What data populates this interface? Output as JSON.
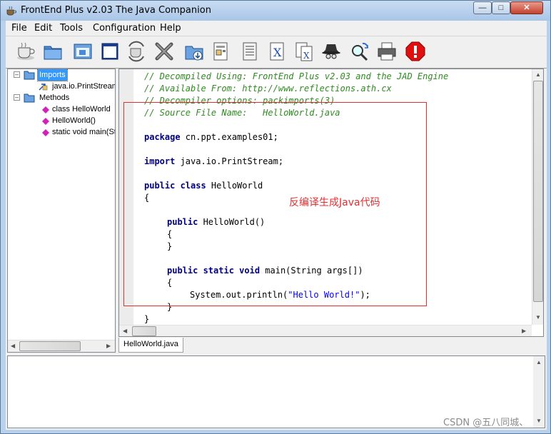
{
  "window": {
    "title": "FrontEnd Plus v2.03 The Java Companion",
    "minimize_label": "—",
    "maximize_label": "□",
    "close_label": "✕"
  },
  "menu": [
    "File",
    "Edit",
    "Tools",
    "Configuration",
    "Help"
  ],
  "toolbar_icons": [
    "coffee-cup-icon",
    "open-folder-icon",
    "open-window-icon",
    "blank-window-icon",
    "recycle-cup-icon",
    "tools-cross-icon",
    "download-folder-icon",
    "properties-doc-icon",
    "list-doc-icon",
    "x-file-icon",
    "x-files-icon",
    "spy-hat-icon",
    "search-refresh-icon",
    "printer-icon",
    "stop-icon"
  ],
  "tree": {
    "imports_label": "Imports",
    "import_item": "java.io.PrintStream",
    "methods_label": "Methods",
    "method_items": [
      "class HelloWorld",
      "HelloWorld()",
      "static void main(St"
    ]
  },
  "editor": {
    "comments": [
      "// Decompiled Using: FrontEnd Plus v2.03 and the JAD Engine",
      "// Available From: http://www.reflections.ath.cx",
      "// Decompiler options: packimports(3)",
      "// Source File Name:   HelloWorld.java"
    ],
    "kw_package": "package",
    "package_name": " cn.ppt.examples01;",
    "kw_import": "import",
    "import_name": " java.io.PrintStream;",
    "kw_public_class": "public class",
    "class_name": " HelloWorld",
    "open_brace": "{",
    "close_brace": "}",
    "kw_public": "public",
    "ctor": " HelloWorld()",
    "kw_public_static_void": "public static void",
    "main_sig": " main(String args[])",
    "println_prefix": "System.out.println(",
    "println_string": "\"Hello World!\"",
    "println_suffix": ");",
    "annotation": "反编译生成Java代码"
  },
  "tab_label": "HelloWorld.java",
  "watermark": "CSDN @五八同城、"
}
